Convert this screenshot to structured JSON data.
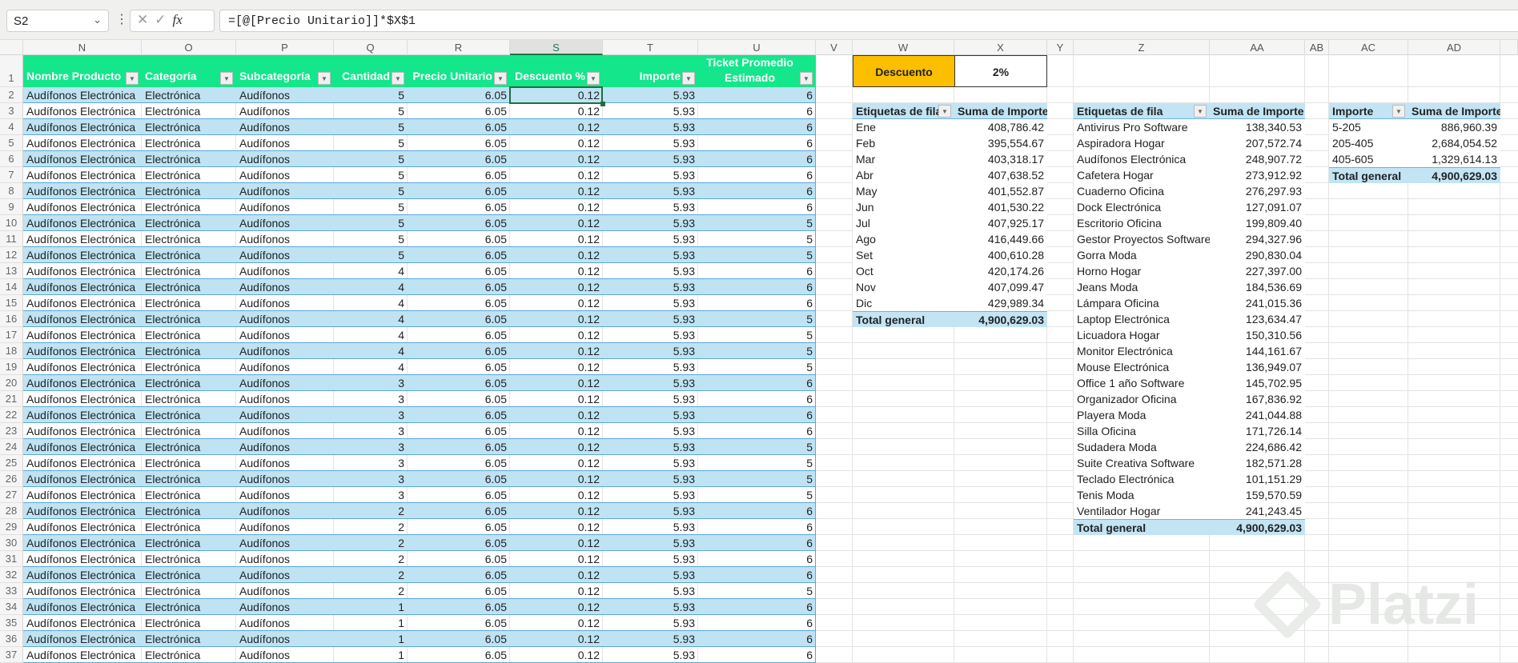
{
  "formula_bar": {
    "name_box": "S2",
    "formula": "=[@[Precio Unitario]]*$X$1",
    "fx_label": "fx"
  },
  "column_headers": [
    "N",
    "O",
    "P",
    "Q",
    "R",
    "S",
    "T",
    "U",
    "V",
    "W",
    "X",
    "Y",
    "Z",
    "AA",
    "AB",
    "AC",
    "AD",
    ""
  ],
  "selected_column": "S",
  "table": {
    "headers": [
      "Nombre Producto",
      "Categoría",
      "Subcategoría",
      "Cantidad",
      "Precio Unitario",
      "Descuento %",
      "Importe",
      "Ticket Promedio Estimado"
    ],
    "rows": [
      [
        "Audífonos Electrónica",
        "Electrónica",
        "Audífonos",
        "5",
        "6.05",
        "0.12",
        "5.93",
        "6"
      ],
      [
        "Audífonos Electrónica",
        "Electrónica",
        "Audífonos",
        "5",
        "6.05",
        "0.12",
        "5.93",
        "6"
      ],
      [
        "Audífonos Electrónica",
        "Electrónica",
        "Audífonos",
        "5",
        "6.05",
        "0.12",
        "5.93",
        "6"
      ],
      [
        "Audífonos Electrónica",
        "Electrónica",
        "Audífonos",
        "5",
        "6.05",
        "0.12",
        "5.93",
        "6"
      ],
      [
        "Audífonos Electrónica",
        "Electrónica",
        "Audífonos",
        "5",
        "6.05",
        "0.12",
        "5.93",
        "6"
      ],
      [
        "Audífonos Electrónica",
        "Electrónica",
        "Audífonos",
        "5",
        "6.05",
        "0.12",
        "5.93",
        "6"
      ],
      [
        "Audífonos Electrónica",
        "Electrónica",
        "Audífonos",
        "5",
        "6.05",
        "0.12",
        "5.93",
        "6"
      ],
      [
        "Audífonos Electrónica",
        "Electrónica",
        "Audífonos",
        "5",
        "6.05",
        "0.12",
        "5.93",
        "6"
      ],
      [
        "Audífonos Electrónica",
        "Electrónica",
        "Audífonos",
        "5",
        "6.05",
        "0.12",
        "5.93",
        "5"
      ],
      [
        "Audífonos Electrónica",
        "Electrónica",
        "Audífonos",
        "5",
        "6.05",
        "0.12",
        "5.93",
        "5"
      ],
      [
        "Audífonos Electrónica",
        "Electrónica",
        "Audífonos",
        "5",
        "6.05",
        "0.12",
        "5.93",
        "5"
      ],
      [
        "Audífonos Electrónica",
        "Electrónica",
        "Audífonos",
        "4",
        "6.05",
        "0.12",
        "5.93",
        "6"
      ],
      [
        "Audífonos Electrónica",
        "Electrónica",
        "Audífonos",
        "4",
        "6.05",
        "0.12",
        "5.93",
        "6"
      ],
      [
        "Audífonos Electrónica",
        "Electrónica",
        "Audífonos",
        "4",
        "6.05",
        "0.12",
        "5.93",
        "6"
      ],
      [
        "Audífonos Electrónica",
        "Electrónica",
        "Audífonos",
        "4",
        "6.05",
        "0.12",
        "5.93",
        "5"
      ],
      [
        "Audífonos Electrónica",
        "Electrónica",
        "Audífonos",
        "4",
        "6.05",
        "0.12",
        "5.93",
        "5"
      ],
      [
        "Audífonos Electrónica",
        "Electrónica",
        "Audífonos",
        "4",
        "6.05",
        "0.12",
        "5.93",
        "5"
      ],
      [
        "Audífonos Electrónica",
        "Electrónica",
        "Audífonos",
        "4",
        "6.05",
        "0.12",
        "5.93",
        "5"
      ],
      [
        "Audífonos Electrónica",
        "Electrónica",
        "Audífonos",
        "3",
        "6.05",
        "0.12",
        "5.93",
        "6"
      ],
      [
        "Audífonos Electrónica",
        "Electrónica",
        "Audífonos",
        "3",
        "6.05",
        "0.12",
        "5.93",
        "6"
      ],
      [
        "Audífonos Electrónica",
        "Electrónica",
        "Audífonos",
        "3",
        "6.05",
        "0.12",
        "5.93",
        "6"
      ],
      [
        "Audífonos Electrónica",
        "Electrónica",
        "Audífonos",
        "3",
        "6.05",
        "0.12",
        "5.93",
        "6"
      ],
      [
        "Audífonos Electrónica",
        "Electrónica",
        "Audífonos",
        "3",
        "6.05",
        "0.12",
        "5.93",
        "5"
      ],
      [
        "Audífonos Electrónica",
        "Electrónica",
        "Audífonos",
        "3",
        "6.05",
        "0.12",
        "5.93",
        "5"
      ],
      [
        "Audífonos Electrónica",
        "Electrónica",
        "Audífonos",
        "3",
        "6.05",
        "0.12",
        "5.93",
        "5"
      ],
      [
        "Audífonos Electrónica",
        "Electrónica",
        "Audífonos",
        "3",
        "6.05",
        "0.12",
        "5.93",
        "5"
      ],
      [
        "Audífonos Electrónica",
        "Electrónica",
        "Audífonos",
        "2",
        "6.05",
        "0.12",
        "5.93",
        "6"
      ],
      [
        "Audífonos Electrónica",
        "Electrónica",
        "Audífonos",
        "2",
        "6.05",
        "0.12",
        "5.93",
        "6"
      ],
      [
        "Audífonos Electrónica",
        "Electrónica",
        "Audífonos",
        "2",
        "6.05",
        "0.12",
        "5.93",
        "6"
      ],
      [
        "Audífonos Electrónica",
        "Electrónica",
        "Audífonos",
        "2",
        "6.05",
        "0.12",
        "5.93",
        "6"
      ],
      [
        "Audífonos Electrónica",
        "Electrónica",
        "Audífonos",
        "2",
        "6.05",
        "0.12",
        "5.93",
        "6"
      ],
      [
        "Audífonos Electrónica",
        "Electrónica",
        "Audífonos",
        "2",
        "6.05",
        "0.12",
        "5.93",
        "5"
      ],
      [
        "Audífonos Electrónica",
        "Electrónica",
        "Audífonos",
        "1",
        "6.05",
        "0.12",
        "5.93",
        "6"
      ],
      [
        "Audífonos Electrónica",
        "Electrónica",
        "Audífonos",
        "1",
        "6.05",
        "0.12",
        "5.93",
        "6"
      ],
      [
        "Audífonos Electrónica",
        "Electrónica",
        "Audífonos",
        "1",
        "6.05",
        "0.12",
        "5.93",
        "6"
      ],
      [
        "Audífonos Electrónica",
        "Electrónica",
        "Audífonos",
        "1",
        "6.05",
        "0.12",
        "5.93",
        "6"
      ]
    ]
  },
  "discount": {
    "label": "Descuento",
    "value": "2%"
  },
  "pivot_month": {
    "headers": [
      "Etiquetas de fila",
      "Suma de Importe"
    ],
    "rows": [
      [
        "Ene",
        "408,786.42"
      ],
      [
        "Feb",
        "395,554.67"
      ],
      [
        "Mar",
        "403,318.17"
      ],
      [
        "Abr",
        "407,638.52"
      ],
      [
        "May",
        "401,552.87"
      ],
      [
        "Jun",
        "401,530.22"
      ],
      [
        "Jul",
        "407,925.17"
      ],
      [
        "Ago",
        "416,449.66"
      ],
      [
        "Set",
        "400,610.28"
      ],
      [
        "Oct",
        "420,174.26"
      ],
      [
        "Nov",
        "407,099.47"
      ],
      [
        "Dic",
        "429,989.34"
      ]
    ],
    "total": [
      "Total general",
      "4,900,629.03"
    ]
  },
  "pivot_product": {
    "headers": [
      "Etiquetas de fila",
      "Suma de Importe"
    ],
    "rows": [
      [
        "Antivirus Pro Software",
        "138,340.53"
      ],
      [
        "Aspiradora Hogar",
        "207,572.74"
      ],
      [
        "Audífonos Electrónica",
        "248,907.72"
      ],
      [
        "Cafetera Hogar",
        "273,912.92"
      ],
      [
        "Cuaderno Oficina",
        "276,297.93"
      ],
      [
        "Dock Electrónica",
        "127,091.07"
      ],
      [
        "Escritorio Oficina",
        "199,809.40"
      ],
      [
        "Gestor Proyectos Software",
        "294,327.96"
      ],
      [
        "Gorra Moda",
        "290,830.04"
      ],
      [
        "Horno Hogar",
        "227,397.00"
      ],
      [
        "Jeans Moda",
        "184,536.69"
      ],
      [
        "Lámpara Oficina",
        "241,015.36"
      ],
      [
        "Laptop Electrónica",
        "123,634.47"
      ],
      [
        "Licuadora Hogar",
        "150,310.56"
      ],
      [
        "Monitor Electrónica",
        "144,161.67"
      ],
      [
        "Mouse Electrónica",
        "136,949.07"
      ],
      [
        "Office 1 año Software",
        "145,702.95"
      ],
      [
        "Organizador Oficina",
        "167,836.92"
      ],
      [
        "Playera Moda",
        "241,044.88"
      ],
      [
        "Silla Oficina",
        "171,726.14"
      ],
      [
        "Sudadera Moda",
        "224,686.42"
      ],
      [
        "Suite Creativa Software",
        "182,571.28"
      ],
      [
        "Teclado Electrónica",
        "101,151.29"
      ],
      [
        "Tenis Moda",
        "159,570.59"
      ],
      [
        "Ventilador Hogar",
        "241,243.45"
      ]
    ],
    "total": [
      "Total general",
      "4,900,629.03"
    ]
  },
  "pivot_range": {
    "headers": [
      "Importe",
      "Suma de Importe"
    ],
    "rows": [
      [
        "5-205",
        "886,960.39"
      ],
      [
        "205-405",
        "2,684,054.52"
      ],
      [
        "405-605",
        "1,329,614.13"
      ]
    ],
    "total": [
      "Total general",
      "4,900,629.03"
    ]
  },
  "watermark": "Platzi",
  "colors": {
    "table_header": "#14e68b",
    "band": "#bfe3f3",
    "discount_label_bg": "#fbbf00",
    "pivot_header": "#c3e4f4"
  }
}
